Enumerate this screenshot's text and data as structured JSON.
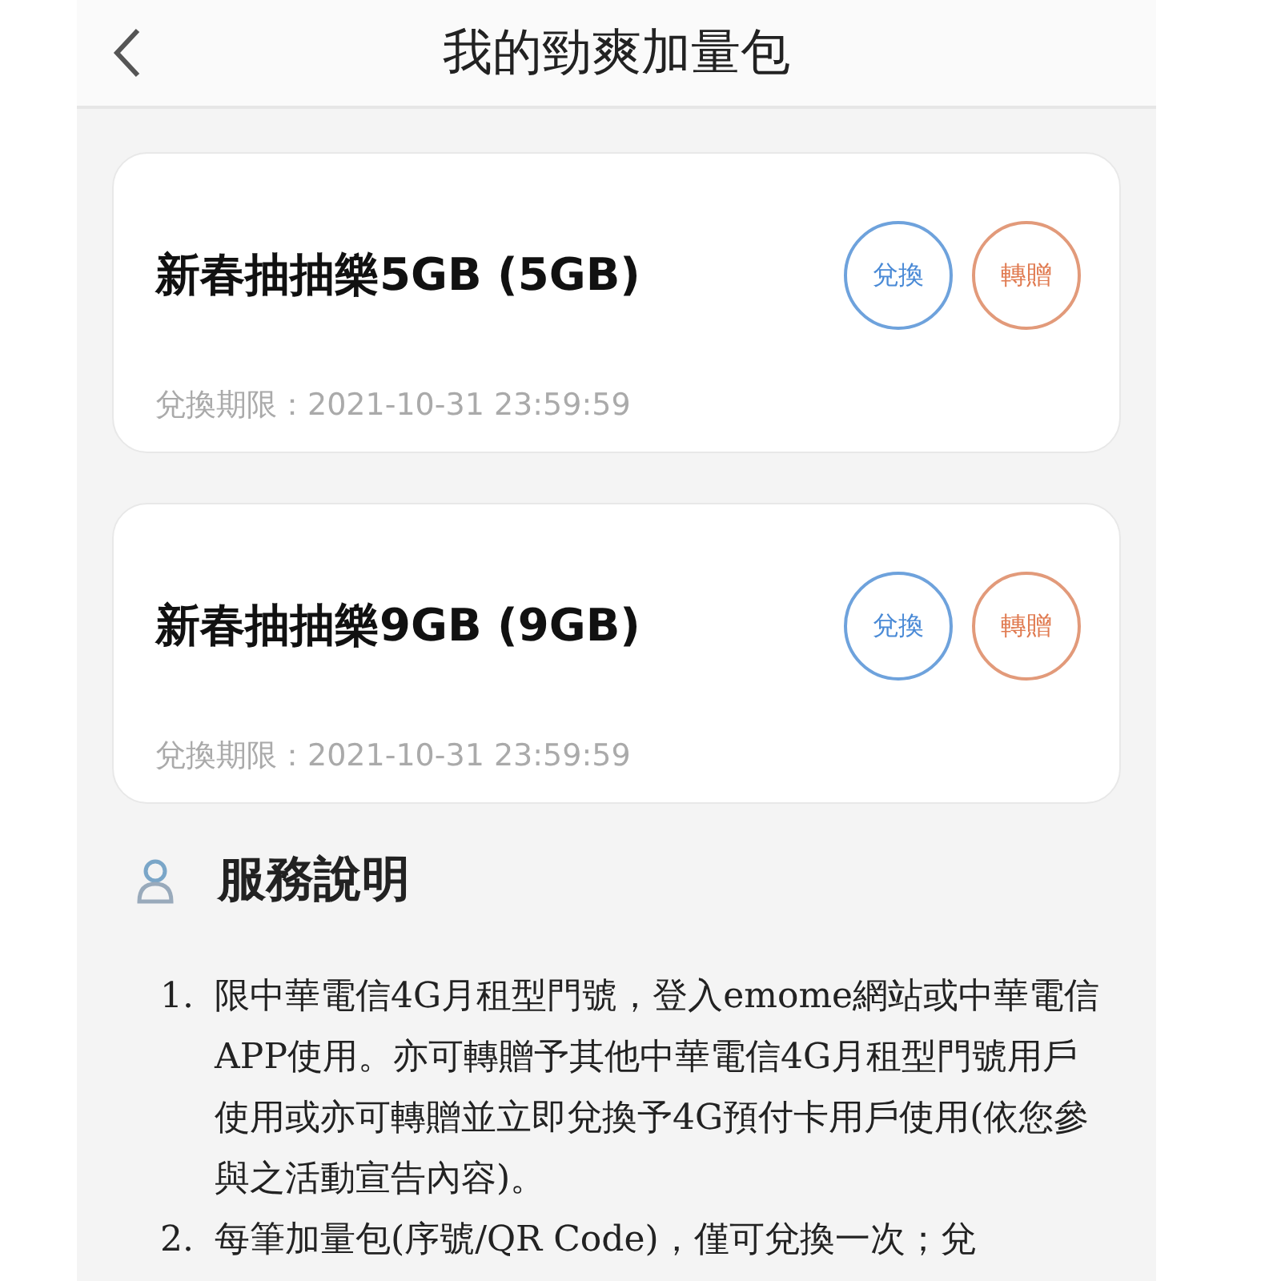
{
  "header": {
    "title": "我的勁爽加量包"
  },
  "packages": [
    {
      "name": "新春抽抽樂5GB (5GB)",
      "expiry": "兌換期限：2021-10-31 23:59:59",
      "actions": [
        {
          "kind": "redeem",
          "label": "兌換"
        },
        {
          "kind": "transfer",
          "label": "轉贈"
        }
      ]
    },
    {
      "name": "新春抽抽樂9GB (9GB)",
      "expiry": "兌換期限：2021-10-31 23:59:59",
      "actions": [
        {
          "kind": "redeem",
          "label": "兌換"
        },
        {
          "kind": "transfer",
          "label": "轉贈"
        }
      ]
    }
  ],
  "service": {
    "title": "服務說明",
    "notes": [
      {
        "number": "1.",
        "text": "限中華電信4G月租型門號，登入emome網站或中華電信APP使用。亦可轉贈予其他中華電信4G月租型門號用戶使用或亦可轉贈並立即兌換予4G預付卡用戶使用(依您參與之活動宣告內容)。"
      },
      {
        "number": "2.",
        "text": "每筆加量包(序號/QR Code)，僅可兌換一次；兌"
      }
    ]
  }
}
